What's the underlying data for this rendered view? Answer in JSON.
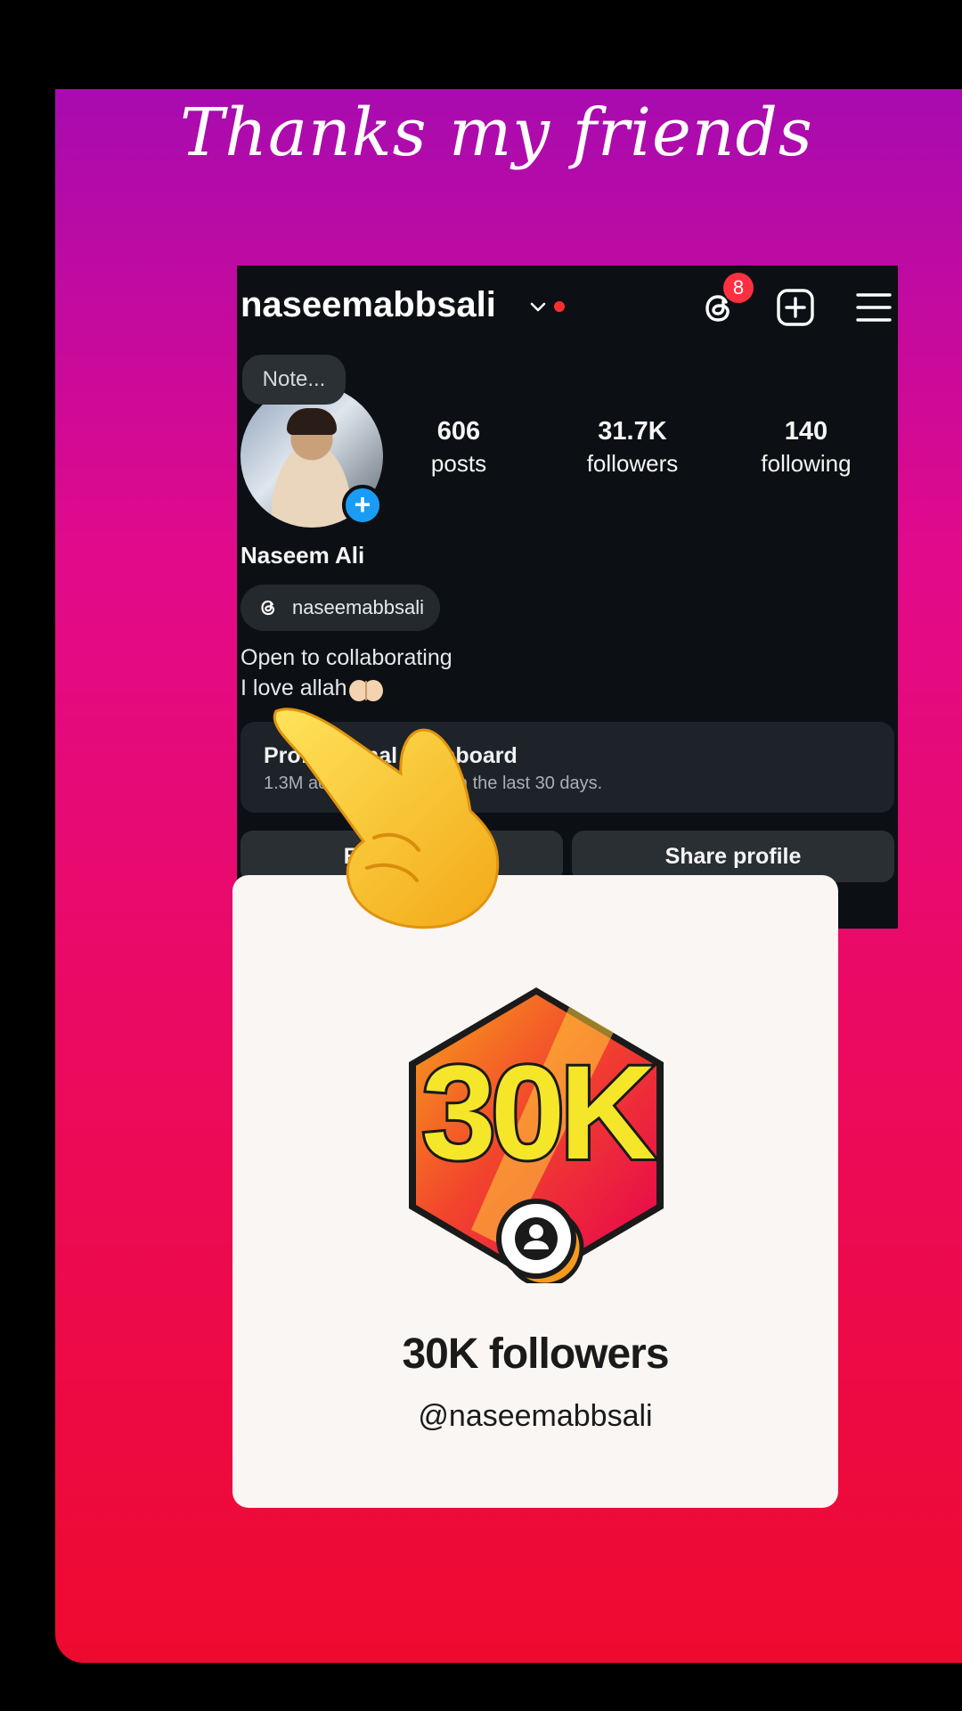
{
  "story": {
    "caption": "Thanks my friends"
  },
  "profile": {
    "username": "naseemabbsali",
    "notification_count": "8",
    "note_placeholder": "Note...",
    "stats": [
      {
        "value": "606",
        "label": "posts"
      },
      {
        "value": "31.7K",
        "label": "followers"
      },
      {
        "value": "140",
        "label": "following"
      }
    ],
    "full_name": "Naseem Ali",
    "threads_handle": "naseemabbsali",
    "bio_line1": "Open to collaborating",
    "bio_line2": "I love allah",
    "dashboard": {
      "title": "Professional dashboard",
      "subtitle": "1.3M accounts reached in the last 30 days."
    },
    "buttons": {
      "edit_profile": "Edit profile",
      "share_profile": "Share profile"
    }
  },
  "milestone": {
    "badge_text": "30K",
    "title": "30K followers",
    "handle": "@naseemabbsali"
  },
  "colors": {
    "gradient_top": "#a80bb0",
    "gradient_bottom": "#ee0a2e",
    "notification_badge": "#ff3040",
    "add_story_blue": "#1a9cf5"
  },
  "icons": [
    "threads-icon",
    "new-post-icon",
    "menu-icon",
    "chevron-down-icon",
    "pointing-hand-icon",
    "person-icon"
  ]
}
